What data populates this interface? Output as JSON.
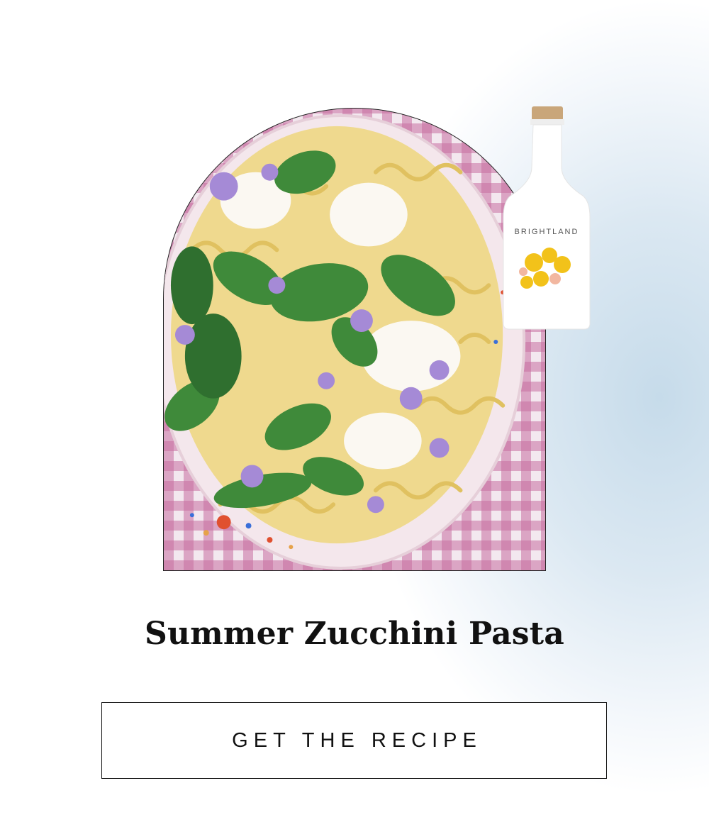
{
  "recipe": {
    "title": "Summer Zucchini Pasta",
    "image_alt": "Bowl of pasta with herbs, burrata and edible flowers on a pink gingham cloth"
  },
  "product": {
    "brand": "BRIGHTLAND"
  },
  "cta": {
    "label": "GET THE RECIPE"
  },
  "colors": {
    "text": "#111111",
    "button_border": "#111111",
    "background_tint": "#c6dbea",
    "gingham": "#c76ea0",
    "herb_green": "#3f8a3a",
    "flower_purple": "#a58ad6"
  }
}
